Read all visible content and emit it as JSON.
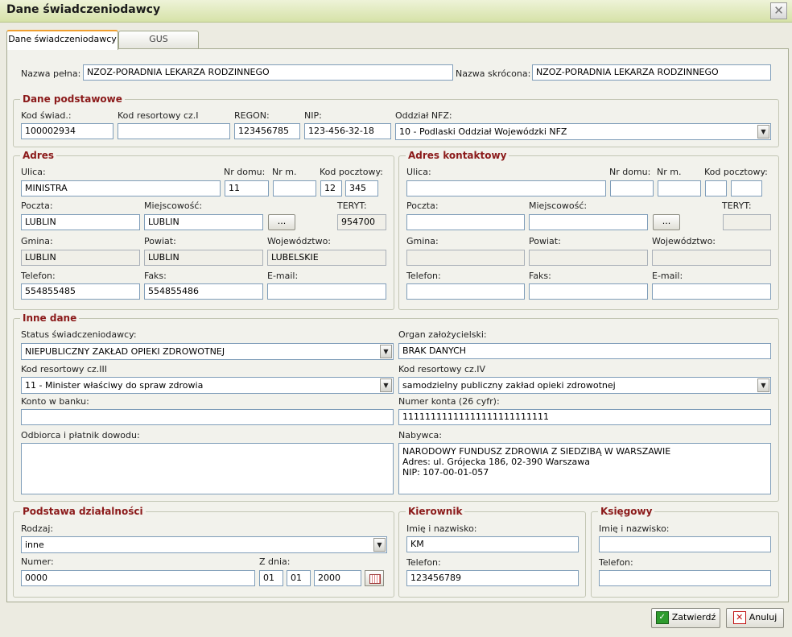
{
  "window": {
    "title": "Dane świadczeniodawcy",
    "close_glyph": "✕"
  },
  "tabs": [
    {
      "label": "Dane świadczeniodawcy"
    },
    {
      "label": "GUS"
    }
  ],
  "top": {
    "nazwa_pelna_label": "Nazwa pełna:",
    "nazwa_pelna": "NZOZ-PORADNIA LEKARZA RODZINNEGO",
    "nazwa_skrocona_label": "Nazwa skrócona:",
    "nazwa_skrocona": "NZOZ-PORADNIA LEKARZA RODZINNEGO"
  },
  "podstawowe": {
    "title": "Dane podstawowe",
    "kod_swiad_label": "Kod świad.:",
    "kod_swiad": "100002934",
    "kod_res1_label": "Kod resortowy cz.I",
    "kod_res1": "",
    "regon_label": "REGON:",
    "regon": "123456785",
    "nip_label": "NIP:",
    "nip": "123-456-32-18",
    "oddzial_label": "Oddział NFZ:",
    "oddzial": "10 - Podlaski Oddział Wojewódzki NFZ"
  },
  "adres": {
    "title": "Adres",
    "ulica_label": "Ulica:",
    "ulica": "MINISTRA",
    "nr_domu_label": "Nr domu:",
    "nr_domu": "11",
    "nr_m_label": "Nr m.",
    "nr_m": "",
    "kod_label": "Kod pocztowy:",
    "kod1": "12",
    "kod2": "345",
    "poczta_label": "Poczta:",
    "poczta": "LUBLIN",
    "miejsc_label": "Miejscowość:",
    "miejsc": "LUBLIN",
    "teryt_label": "TERYT:",
    "teryt": "954700",
    "gmina_label": "Gmina:",
    "gmina": "LUBLIN",
    "powiat_label": "Powiat:",
    "powiat": "LUBLIN",
    "woj_label": "Województwo:",
    "woj": "LUBELSKIE",
    "tel_label": "Telefon:",
    "tel": "554855485",
    "faks_label": "Faks:",
    "faks": "554855486",
    "email_label": "E-mail:",
    "email": "",
    "browse": "..."
  },
  "adres_k": {
    "title": "Adres kontaktowy",
    "ulica_label": "Ulica:",
    "nr_domu_label": "Nr domu:",
    "nr_m_label": "Nr m.",
    "kod_label": "Kod pocztowy:",
    "poczta_label": "Poczta:",
    "miejsc_label": "Miejscowość:",
    "teryt_label": "TERYT:",
    "gmina_label": "Gmina:",
    "powiat_label": "Powiat:",
    "woj_label": "Województwo:",
    "tel_label": "Telefon:",
    "faks_label": "Faks:",
    "email_label": "E-mail:",
    "browse": "..."
  },
  "inne": {
    "title": "Inne dane",
    "status_label": "Status świadczeniodawcy:",
    "status": "NIEPUBLICZNY ZAKŁAD OPIEKI ZDROWOTNEJ",
    "organ_label": "Organ założycielski:",
    "organ": "BRAK DANYCH",
    "kod3_label": "Kod resortowy cz.III",
    "kod3": "11 - Minister właściwy do spraw zdrowia",
    "kod4_label": "Kod resortowy cz.IV",
    "kod4": "samodzielny publiczny zakład opieki zdrowotnej",
    "konto_label": "Konto w banku:",
    "konto": "",
    "numer_konta_label": "Numer konta (26 cyfr):",
    "numer_konta": "11111111111111111111111111",
    "odbiorca_label": "Odbiorca i płatnik dowodu:",
    "nabywca_label": "Nabywca:",
    "nabywca_l1": "NARODOWY FUNDUSZ ZDROWIA Z SIEDZIBĄ W WARSZAWIE",
    "nabywca_l2": "Adres: ul. Grójecka 186, 02-390 Warszawa",
    "nabywca_l3": "NIP: 107-00-01-057"
  },
  "podstawa": {
    "title": "Podstawa działalności",
    "rodzaj_label": "Rodzaj:",
    "rodzaj": "inne",
    "numer_label": "Numer:",
    "numer": "0000",
    "zdnia_label": "Z dnia:",
    "d": "01",
    "m": "01",
    "y": "2000"
  },
  "kierownik": {
    "title": "Kierownik",
    "imie_label": "Imię i nazwisko:",
    "imie": "KM",
    "tel_label": "Telefon:",
    "tel": "123456789"
  },
  "ksiegowy": {
    "title": "Księgowy",
    "imie_label": "Imię i nazwisko:",
    "tel_label": "Telefon:"
  },
  "footer": {
    "ok_label": "Zatwierdź",
    "cancel_label": "Anuluj",
    "ok_glyph": "✓",
    "cancel_glyph": "✕"
  },
  "glyphs": {
    "arrow": "▼"
  }
}
